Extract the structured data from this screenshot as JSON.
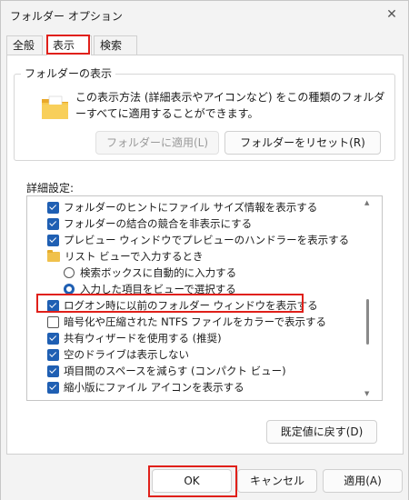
{
  "window": {
    "title": "フォルダー オプション"
  },
  "tabs": [
    {
      "label": "全般"
    },
    {
      "label": "表示"
    },
    {
      "label": "検索"
    }
  ],
  "folder_views": {
    "title": "フォルダーの表示",
    "description": "この表示方法 (詳細表示やアイコンなど) をこの種類のフォルダーすべてに適用することができます。",
    "apply_button": "フォルダーに適用(L)",
    "reset_button": "フォルダーをリセット(R)"
  },
  "advanced": {
    "label": "詳細設定:",
    "items": [
      {
        "label": "フォルダーのヒントにファイル サイズ情報を表示する",
        "type": "checkbox",
        "checked": true
      },
      {
        "label": "フォルダーの結合の競合を非表示にする",
        "type": "checkbox",
        "checked": true
      },
      {
        "label": "プレビュー ウィンドウでプレビューのハンドラーを表示する",
        "type": "checkbox",
        "checked": true
      },
      {
        "label": "リスト ビューで入力するとき",
        "type": "folder"
      },
      {
        "label": "検索ボックスに自動的に入力する",
        "type": "radio",
        "checked": false
      },
      {
        "label": "入力した項目をビューで選択する",
        "type": "radio",
        "checked": true
      },
      {
        "label": "ログオン時に以前のフォルダー ウィンドウを表示する",
        "type": "checkbox",
        "checked": true
      },
      {
        "label": "暗号化や圧縮された NTFS ファイルをカラーで表示する",
        "type": "checkbox",
        "checked": false
      },
      {
        "label": "共有ウィザードを使用する (推奨)",
        "type": "checkbox",
        "checked": true
      },
      {
        "label": "空のドライブは表示しない",
        "type": "checkbox",
        "checked": true
      },
      {
        "label": "項目間のスペースを減らす (コンパクト ビュー)",
        "type": "checkbox",
        "checked": true
      },
      {
        "label": "縮小版にファイル アイコンを表示する",
        "type": "checkbox",
        "checked": true
      }
    ]
  },
  "restore_defaults": "既定値に戻す(D)",
  "footer": {
    "ok": "OK",
    "cancel": "キャンセル",
    "apply": "適用(A)"
  }
}
